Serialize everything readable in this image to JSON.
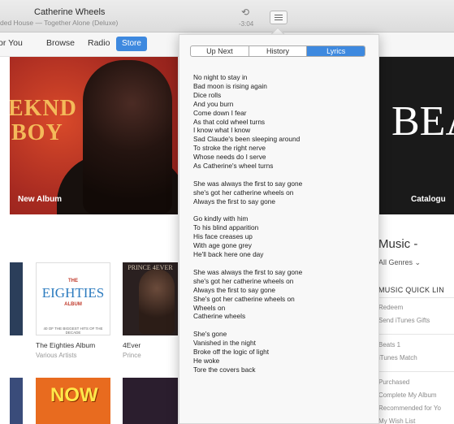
{
  "now_playing": {
    "title": "Catherine Wheels",
    "subtitle": "ded House — Together Alone (Deluxe)",
    "time": "-3:04"
  },
  "nav": {
    "items": [
      "or You",
      "Browse",
      "Radio"
    ],
    "active": "Store"
  },
  "hero": {
    "left_label": "New Album",
    "left_line1": "EKND",
    "left_line2": "BOY",
    "right_label": "Catalogu",
    "right_art": "BEA"
  },
  "albums": [
    {
      "title": "The Eighties Album",
      "artist": "Various Artists",
      "art_the": "THE",
      "art_big": "EIGHTIES",
      "art_album": "ALBUM",
      "art_small": "40 OF THE BIGGEST HITS OF THE DECADE"
    },
    {
      "title": "4Ever",
      "artist": "Prince",
      "art_top": "PRINCE 4EVER"
    }
  ],
  "bottom_row": {
    "now_art": "NOW"
  },
  "music": {
    "heading": "Music -",
    "genres": "All Genres ⌄",
    "quick_links_title": "MUSIC QUICK LIN",
    "quick_links": [
      "Redeem",
      "Send iTunes Gifts",
      "Beats 1",
      "iTunes Match",
      "Purchased",
      "Complete My Album",
      "Recommended for Yo",
      "My Wish List"
    ]
  },
  "lyrics_panel": {
    "tabs": [
      "Up Next",
      "History",
      "Lyrics"
    ],
    "active_tab": "Lyrics",
    "stanzas": [
      [
        "No night to stay in",
        "Bad moon is rising again",
        "Dice rolls",
        "And you burn",
        "Come down I fear",
        "As that cold wheel turns",
        "I know what I know",
        "Sad Claude's been sleeping around",
        "To stroke the right nerve",
        "Whose needs do I serve",
        "As Catherine's wheel turns"
      ],
      [
        "She was always the first to say gone",
        "she's got her catherine wheels on",
        "Always the first to say gone"
      ],
      [
        "Go kindly with him",
        "To his blind apparition",
        "His face creases up",
        "With age gone grey",
        "He'll back here one day"
      ],
      [
        "She was always the first to say gone",
        "she's got her catherine wheels on",
        "Always the first to say gone",
        "She's got her catherine wheels on",
        "Wheels on",
        "Catherine wheels"
      ],
      [
        "She's gone",
        "Vanished in the night",
        "Broke off the logic of light",
        "He woke",
        "Tore the covers back"
      ]
    ]
  },
  "colors": {
    "accent": "#3e89df",
    "hero_red": "#b72f24",
    "hero_text": "#f4ba5a"
  },
  "icons": [
    "repeat-icon",
    "lyrics-list-icon"
  ]
}
